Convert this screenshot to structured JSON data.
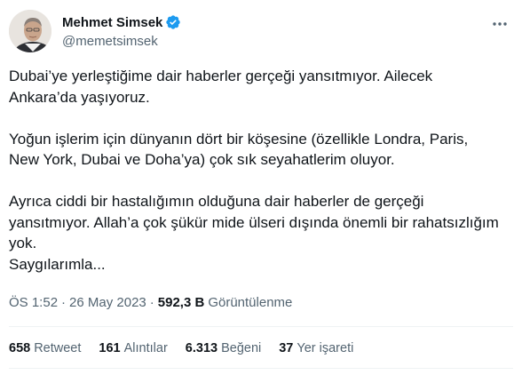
{
  "author": {
    "display_name": "Mehmet Simsek",
    "handle": "@memetsimsek",
    "verified_color": "#1d9bf0"
  },
  "icons": {
    "verified": "verified-badge-icon",
    "more": "more-options-icon",
    "avatar": "avatar-portrait"
  },
  "tweet": {
    "paragraphs": [
      "Dubai’ye yerleştiğime dair haberler gerçeği yansıtmıyor. Ailecek\nAnkara’da yaşıyoruz.",
      "Yoğun işlerim için dünyanın dört bir köşesine (özellikle Londra, Paris,\nNew York, Dubai ve Doha’ya) çok sık seyahatlerim oluyor.",
      "Ayrıca ciddi bir hastalığımın olduğuna dair haberler de gerçeği\nyansıtmıyor. Allah’a çok şükür mide ülseri dışında önemli bir rahatsızlığım\nyok.\nSaygılarımla..."
    ]
  },
  "meta": {
    "time": "ÖS 1:52",
    "separator": "·",
    "date": "26 May 2023",
    "views_count": "592,3 B",
    "views_label": "Görüntülenme"
  },
  "stats": [
    {
      "count": "658",
      "label": "Retweet"
    },
    {
      "count": "161",
      "label": "Alıntılar"
    },
    {
      "count": "6.313",
      "label": "Beğeni"
    },
    {
      "count": "37",
      "label": "Yer işareti"
    }
  ]
}
